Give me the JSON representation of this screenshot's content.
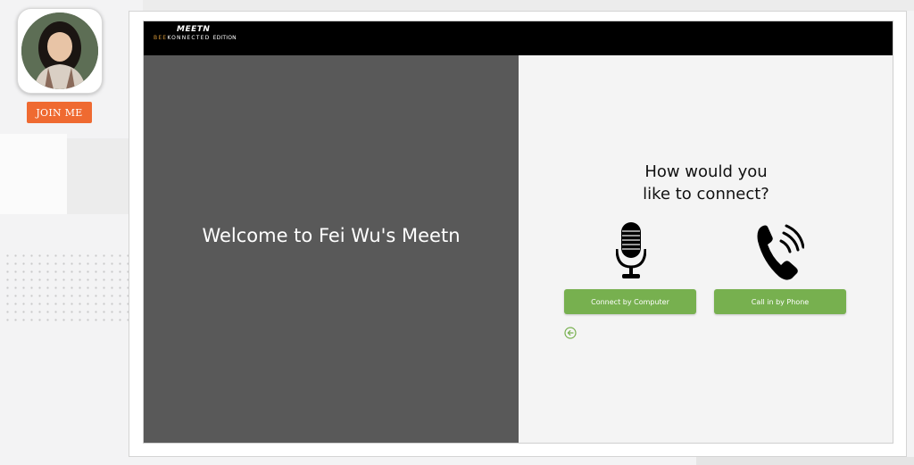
{
  "sidebar": {
    "join_label": "JOIN ME"
  },
  "header": {
    "logo_top": "MEETN",
    "logo_bee": "BEE",
    "logo_connected": "KONNECTED",
    "logo_edition": "EDITION"
  },
  "welcome": {
    "title": "Welcome to Fei Wu's Meetn"
  },
  "connect": {
    "question_line1": "How would you",
    "question_line2": "like to connect?",
    "computer_label": "Connect by Computer",
    "phone_label": "Call in by Phone"
  },
  "icons": {
    "microphone": "microphone-icon",
    "phone": "phone-icon",
    "back": "back-arrow-icon"
  },
  "colors": {
    "accent_green": "#77b04f",
    "join_orange": "#ef6a31",
    "left_panel": "#595959",
    "topbar": "#000000"
  }
}
